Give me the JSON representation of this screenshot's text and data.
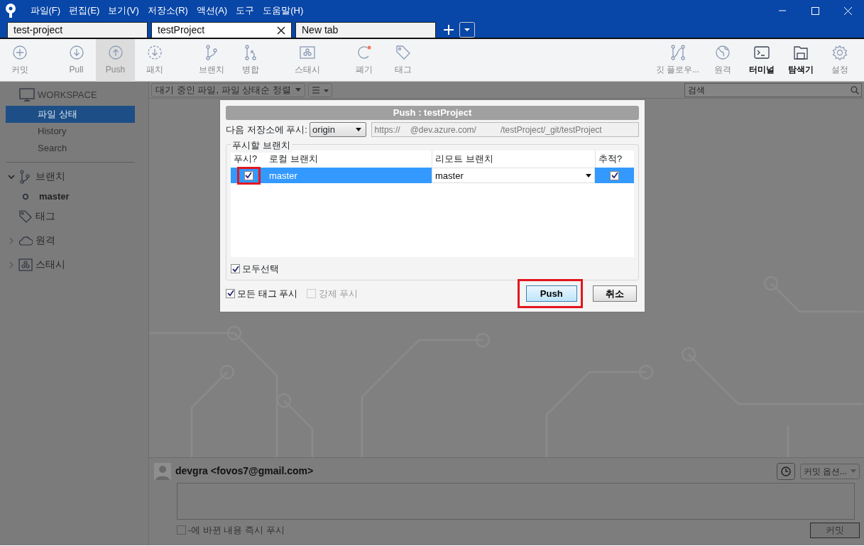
{
  "window": {
    "menu": [
      "파일(F)",
      "편집(E)",
      "보기(V)",
      "저장소(R)",
      "액션(A)",
      "도구",
      "도움말(H)"
    ]
  },
  "tabs": [
    {
      "label": "test-project",
      "selected": false
    },
    {
      "label": "testProject",
      "selected": true
    },
    {
      "label": "New tab",
      "selected": false
    }
  ],
  "toolbar": {
    "left_groups": [
      [
        {
          "label": "커밋",
          "selected": false,
          "disabled": true
        }
      ],
      [
        {
          "label": "Pull",
          "selected": false,
          "disabled": true
        },
        {
          "label": "Push",
          "selected": true,
          "disabled": true
        },
        {
          "label": "패치",
          "selected": false,
          "disabled": true
        }
      ],
      [
        {
          "label": "브랜치",
          "selected": false,
          "disabled": true
        },
        {
          "label": "병합",
          "selected": false,
          "disabled": true
        }
      ],
      [
        {
          "label": "스태시",
          "selected": false,
          "disabled": true
        }
      ],
      [
        {
          "label": "폐기",
          "selected": false,
          "disabled": true
        },
        {
          "label": "태그",
          "selected": false,
          "disabled": true
        }
      ]
    ],
    "right": [
      {
        "label": "깃 플로우...",
        "selected": false,
        "disabled": true
      },
      {
        "label": "원격",
        "selected": false,
        "disabled": true
      },
      {
        "label": "터미널",
        "selected": false,
        "disabled": false
      },
      {
        "label": "탐색기",
        "selected": false,
        "disabled": false
      },
      {
        "label": "설정",
        "selected": false,
        "disabled": true
      }
    ]
  },
  "sidebar": {
    "workspace": {
      "label": "WORKSPACE",
      "items": [
        {
          "label": "파일 상태",
          "selected": true
        },
        {
          "label": "History",
          "selected": false
        },
        {
          "label": "Search",
          "selected": false
        }
      ]
    },
    "sections": [
      {
        "label": "브랜치",
        "kind": "group",
        "expanded": true,
        "children": [
          {
            "label": "master",
            "current": true
          }
        ]
      },
      {
        "label": "태그",
        "kind": "leaf"
      },
      {
        "label": "원격",
        "kind": "group",
        "expanded": false
      },
      {
        "label": "스태시",
        "kind": "group",
        "expanded": false
      }
    ]
  },
  "filter": {
    "sort": "대기 중인 파일, 파일 상태순 정렬",
    "search_placeholder": "검색"
  },
  "dialog": {
    "title": "Push :  testProject",
    "remote_label": "다음 저장소에 푸시:",
    "remote": "origin",
    "url": [
      "https://",
      "@dev.azure.com/",
      "/testProject/_git/testProject"
    ],
    "group_label": "푸시할 브랜치",
    "columns": [
      "푸시?",
      "로컬 브랜치",
      "리모트 브랜치",
      "추적?"
    ],
    "rows": [
      {
        "push": true,
        "highlighted": true,
        "local": "master",
        "remote": "master",
        "track": true,
        "selected": true
      }
    ],
    "select_all": {
      "label": "모두선택",
      "checked": true
    },
    "options": [
      {
        "label": "모든 태그 푸시",
        "checked": true,
        "disabled": false
      },
      {
        "label": "강제 푸시",
        "checked": false,
        "disabled": true
      }
    ],
    "buttons": [
      {
        "label": "Push",
        "kind": "primary",
        "highlighted": true
      },
      {
        "label": "취소",
        "kind": "secondary",
        "highlighted": false
      }
    ]
  },
  "commit": {
    "author": "devgra <fovos7@gmail.com>",
    "options": "커밋 옵션...",
    "push_now": {
      "label": "-에 바뀐 내용 즉시 푸시",
      "checked": false,
      "disabled": true
    },
    "commit_button": "커밋"
  }
}
